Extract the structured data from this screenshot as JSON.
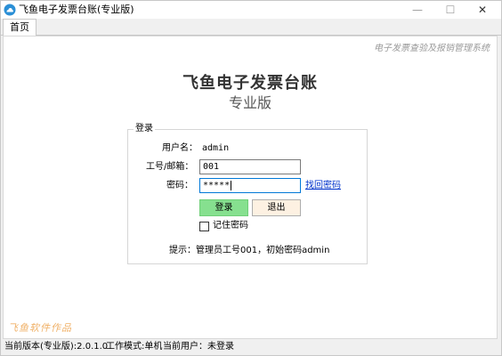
{
  "window": {
    "title": "飞鱼电子发票台账(专业版)",
    "minimize_glyph": "—",
    "maximize_glyph": "☐",
    "close_glyph": "✕"
  },
  "tabs": [
    {
      "label": "首页"
    }
  ],
  "header": {
    "corner_subtitle": "电子发票查验及报销管理系统",
    "title": "飞鱼电子发票台账",
    "subtitle": "专业版"
  },
  "login": {
    "group_label": "登录",
    "username_label": "用户名：",
    "username_value": "admin",
    "employee_label": "工号/邮箱：",
    "employee_value": "001",
    "password_label": "密码：",
    "password_value": "*****",
    "forgot_link": "找回密码",
    "login_button": "登录",
    "exit_button": "退出",
    "remember_label": "记住密码",
    "remember_checked": false,
    "hint": "提示：管理员工号001，初始密码admin"
  },
  "watermark": "飞鱼软件作品",
  "statusbar": {
    "version": "当前版本(专业版):2.0.1.0",
    "mode": "工作模式:单机",
    "user": "当前用户：未登录"
  }
}
